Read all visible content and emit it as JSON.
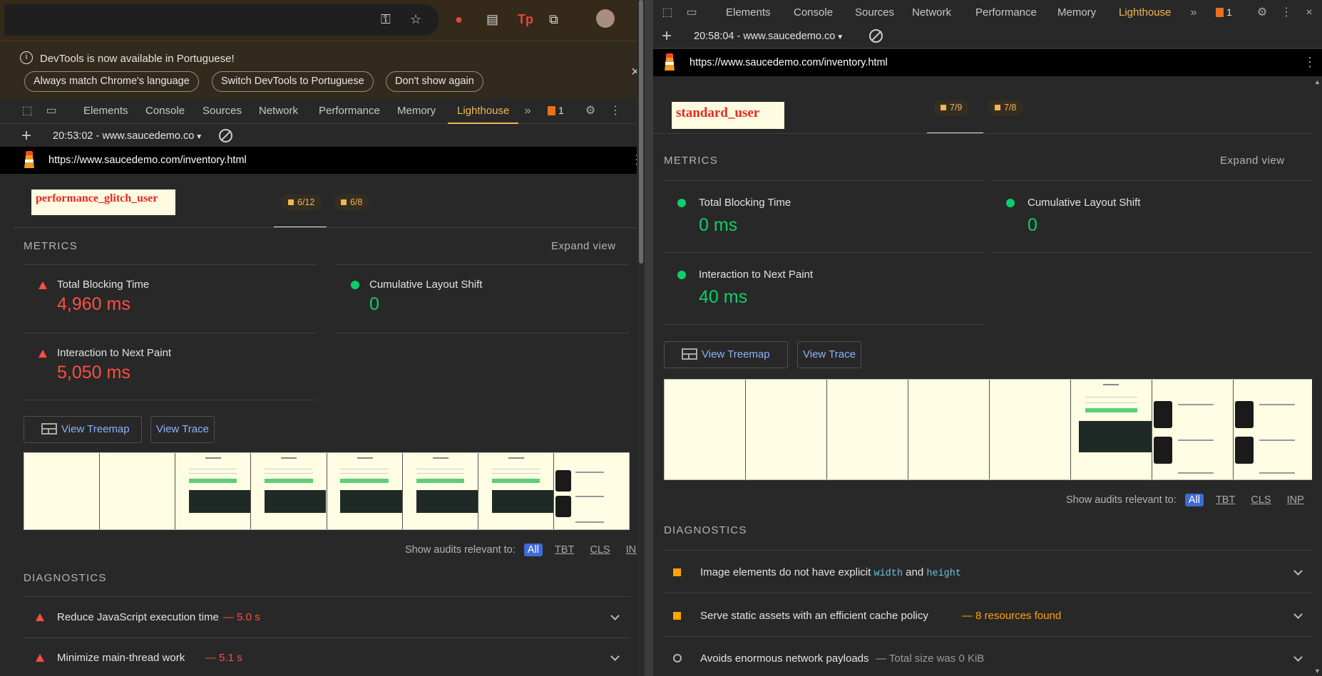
{
  "browser": {
    "icons": [
      "key-icon",
      "star-icon",
      "extension-red-icon",
      "reader-icon",
      "tp-extension-icon",
      "puzzle-icon",
      "avatar"
    ]
  },
  "infobar": {
    "message": "DevTools is now available in Portuguese!",
    "buttons": [
      "Always match Chrome's language",
      "Switch DevTools to Portuguese",
      "Don't show again"
    ]
  },
  "tabs": [
    "Elements",
    "Console",
    "Sources",
    "Network",
    "Performance",
    "Memory",
    "Lighthouse"
  ],
  "issue_count": "1",
  "left": {
    "session": "20:53:02 - www.saucedemo.co",
    "url": "https://www.saucedemo.com/inventory.html",
    "user": "performance_glitch_user",
    "summary": [
      "6/12",
      "6/8"
    ],
    "metrics_title": "METRICS",
    "expand": "Expand view",
    "metrics": [
      {
        "name": "Total Blocking Time",
        "value": "4,960 ms",
        "status": "fail"
      },
      {
        "name": "Cumulative Layout Shift",
        "value": "0",
        "status": "pass"
      },
      {
        "name": "Interaction to Next Paint",
        "value": "5,050 ms",
        "status": "fail"
      }
    ],
    "buttons": {
      "treemap": "View Treemap",
      "trace": "View Trace"
    },
    "filter": {
      "label": "Show audits relevant to:",
      "chips": [
        "All",
        "TBT",
        "CLS",
        "INP"
      ]
    },
    "diagnostics_title": "DIAGNOSTICS",
    "diagnostics": [
      {
        "title": "Reduce JavaScript execution time",
        "sep": "—",
        "detail": "5.0 s"
      },
      {
        "title": "Minimize main-thread work",
        "sep": "—",
        "detail": "5.1 s"
      }
    ]
  },
  "right": {
    "session": "20:58:04 - www.saucedemo.co",
    "url": "https://www.saucedemo.com/inventory.html",
    "user": "standard_user",
    "summary": [
      "7/9",
      "7/8"
    ],
    "metrics_title": "METRICS",
    "expand": "Expand view",
    "metrics": [
      {
        "name": "Total Blocking Time",
        "value": "0 ms",
        "status": "pass"
      },
      {
        "name": "Cumulative Layout Shift",
        "value": "0",
        "status": "pass"
      },
      {
        "name": "Interaction to Next Paint",
        "value": "40 ms",
        "status": "pass"
      }
    ],
    "buttons": {
      "treemap": "View Treemap",
      "trace": "View Trace"
    },
    "filter": {
      "label": "Show audits relevant to:",
      "chips": [
        "All",
        "TBT",
        "CLS",
        "INP"
      ]
    },
    "diagnostics_title": "DIAGNOSTICS",
    "diagnostics": [
      {
        "pre": "Image elements do not have explicit ",
        "code1": "width",
        "mid": " and ",
        "code2": "height"
      },
      {
        "title": "Serve static assets with an efficient cache policy",
        "sep": "—",
        "detail": "8 resources found"
      },
      {
        "title": "Avoids enormous network payloads",
        "sep": "—",
        "detail": "Total size was 0 KiB"
      }
    ]
  },
  "colors": {
    "fail": "#ff4e42",
    "pass": "#0cce6b",
    "average": "#ffa400",
    "accent": "#f2b552",
    "link": "#8ab4f8"
  }
}
